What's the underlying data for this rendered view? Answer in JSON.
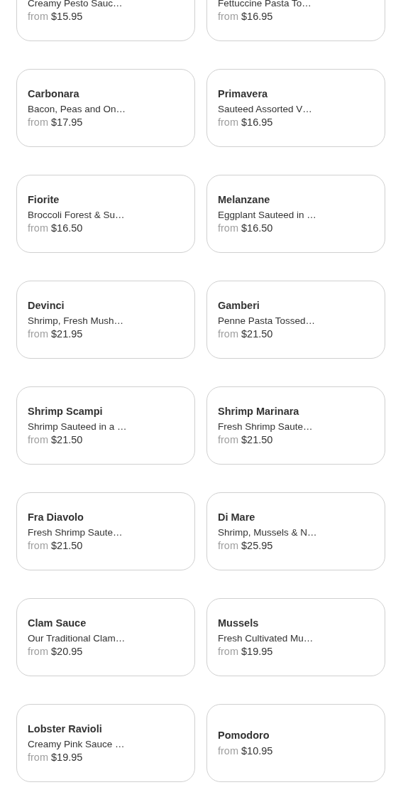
{
  "menu_items": [
    {
      "description": "Creamy Pesto Sauc…",
      "from_label": "from",
      "price": "$15.95"
    },
    {
      "description": "Fettuccine Pasta To…",
      "from_label": "from",
      "price": "$16.95"
    },
    {
      "name": "Carbonara",
      "description": "Bacon, Peas and On…",
      "from_label": "from",
      "price": "$17.95"
    },
    {
      "name": "Primavera",
      "description": "Sauteed Assorted V…",
      "from_label": "from",
      "price": "$16.95"
    },
    {
      "name": "Fiorite",
      "description": "Broccoli Forest & Su…",
      "from_label": "from",
      "price": "$16.50"
    },
    {
      "name": "Melanzane",
      "description": "Eggplant Sauteed in …",
      "from_label": "from",
      "price": "$16.50"
    },
    {
      "name": "Devinci",
      "description": "Shrimp, Fresh Mush…",
      "from_label": "from",
      "price": "$21.95"
    },
    {
      "name": "Gamberi",
      "description": "Penne Pasta Tossed…",
      "from_label": "from",
      "price": "$21.50"
    },
    {
      "name": "Shrimp Scampi",
      "description": "Shrimp Sauteed in a …",
      "from_label": "from",
      "price": "$21.50"
    },
    {
      "name": "Shrimp Marinara",
      "description": "Fresh Shrimp Saute…",
      "from_label": "from",
      "price": "$21.50"
    },
    {
      "name": "Fra Diavolo",
      "description": "Fresh Shrimp Saute…",
      "from_label": "from",
      "price": "$21.50"
    },
    {
      "name": "Di Mare",
      "description": "Shrimp, Mussels & N…",
      "from_label": "from",
      "price": "$25.95"
    },
    {
      "name": "Clam Sauce",
      "description": "Our Traditional Clam…",
      "from_label": "from",
      "price": "$20.95"
    },
    {
      "name": "Mussels",
      "description": "Fresh Cultivated Mu…",
      "from_label": "from",
      "price": "$19.95"
    },
    {
      "name": "Lobster Ravioli",
      "description": "Creamy Pink Sauce …",
      "from_label": "from",
      "price": "$19.95"
    },
    {
      "name": "Pomodoro",
      "from_label": "from",
      "price": "$10.95"
    }
  ]
}
